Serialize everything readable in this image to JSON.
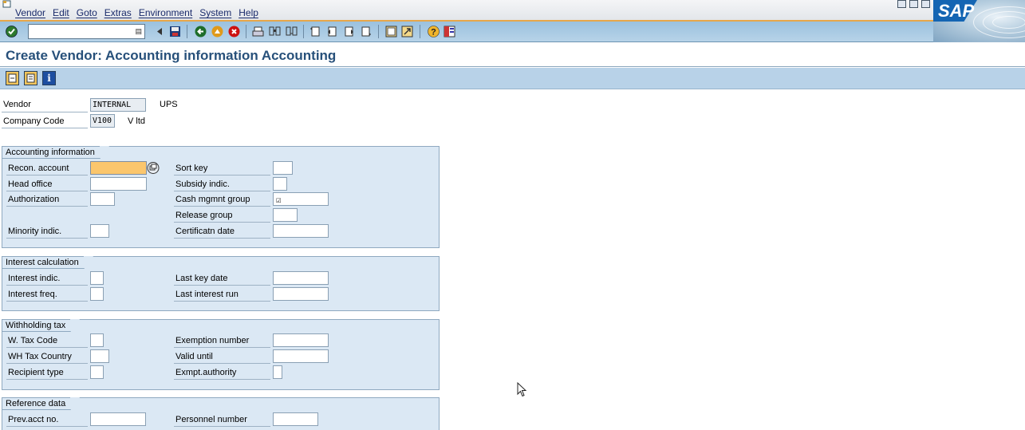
{
  "menu": [
    "Vendor",
    "Edit",
    "Goto",
    "Extras",
    "Environment",
    "System",
    "Help"
  ],
  "brand": {
    "logo_text": "SAP",
    "accent": "#1465b3"
  },
  "toolbar": {
    "command_value": "",
    "icons": [
      "enter-icon",
      "back-icon",
      "save-icon",
      "back-arrow-icon",
      "exit-icon",
      "cancel-icon",
      "print-icon",
      "find-icon",
      "find-next-icon",
      "first-page-icon",
      "prev-page-icon",
      "next-page-icon",
      "last-page-icon",
      "create-session-icon",
      "shortcut-icon",
      "help-icon",
      "layout-menu-icon"
    ]
  },
  "title": "Create Vendor: Accounting information Accounting",
  "app_toolbar": {
    "icons": [
      "prev-screen-icon",
      "next-screen-icon",
      "info-icon"
    ],
    "info_glyph": "i"
  },
  "header": {
    "vendor_label": "Vendor",
    "vendor_value": "INTERNAL",
    "vendor_name": "UPS",
    "company_label": "Company Code",
    "company_value": "V100",
    "company_name": "V ltd"
  },
  "groups": {
    "accounting": {
      "title": "Accounting information",
      "recon_account": "Recon. account",
      "head_office": "Head office",
      "authorization": "Authorization",
      "minority": "Minority indic.",
      "sort_key": "Sort key",
      "subsidy": "Subsidy indic.",
      "cash_mgmt": "Cash mgmnt group",
      "cash_mgmt_value": "☑",
      "release_group": "Release group",
      "cert_date": "Certificatn date"
    },
    "interest": {
      "title": "Interest calculation",
      "interest_indic": "Interest indic.",
      "interest_freq": "Interest freq.",
      "last_key_date": "Last key date",
      "last_interest_run": "Last interest run"
    },
    "withholding": {
      "title": "Withholding tax",
      "w_tax_code": "W. Tax Code",
      "wh_tax_country": "WH Tax Country",
      "recipient_type": "Recipient type",
      "exemption_number": "Exemption number",
      "valid_until": "Valid  until",
      "exempt_authority": "Exmpt.authority"
    },
    "reference": {
      "title": "Reference data",
      "prev_acct": "Prev.acct no.",
      "personnel_number": "Personnel number"
    }
  }
}
